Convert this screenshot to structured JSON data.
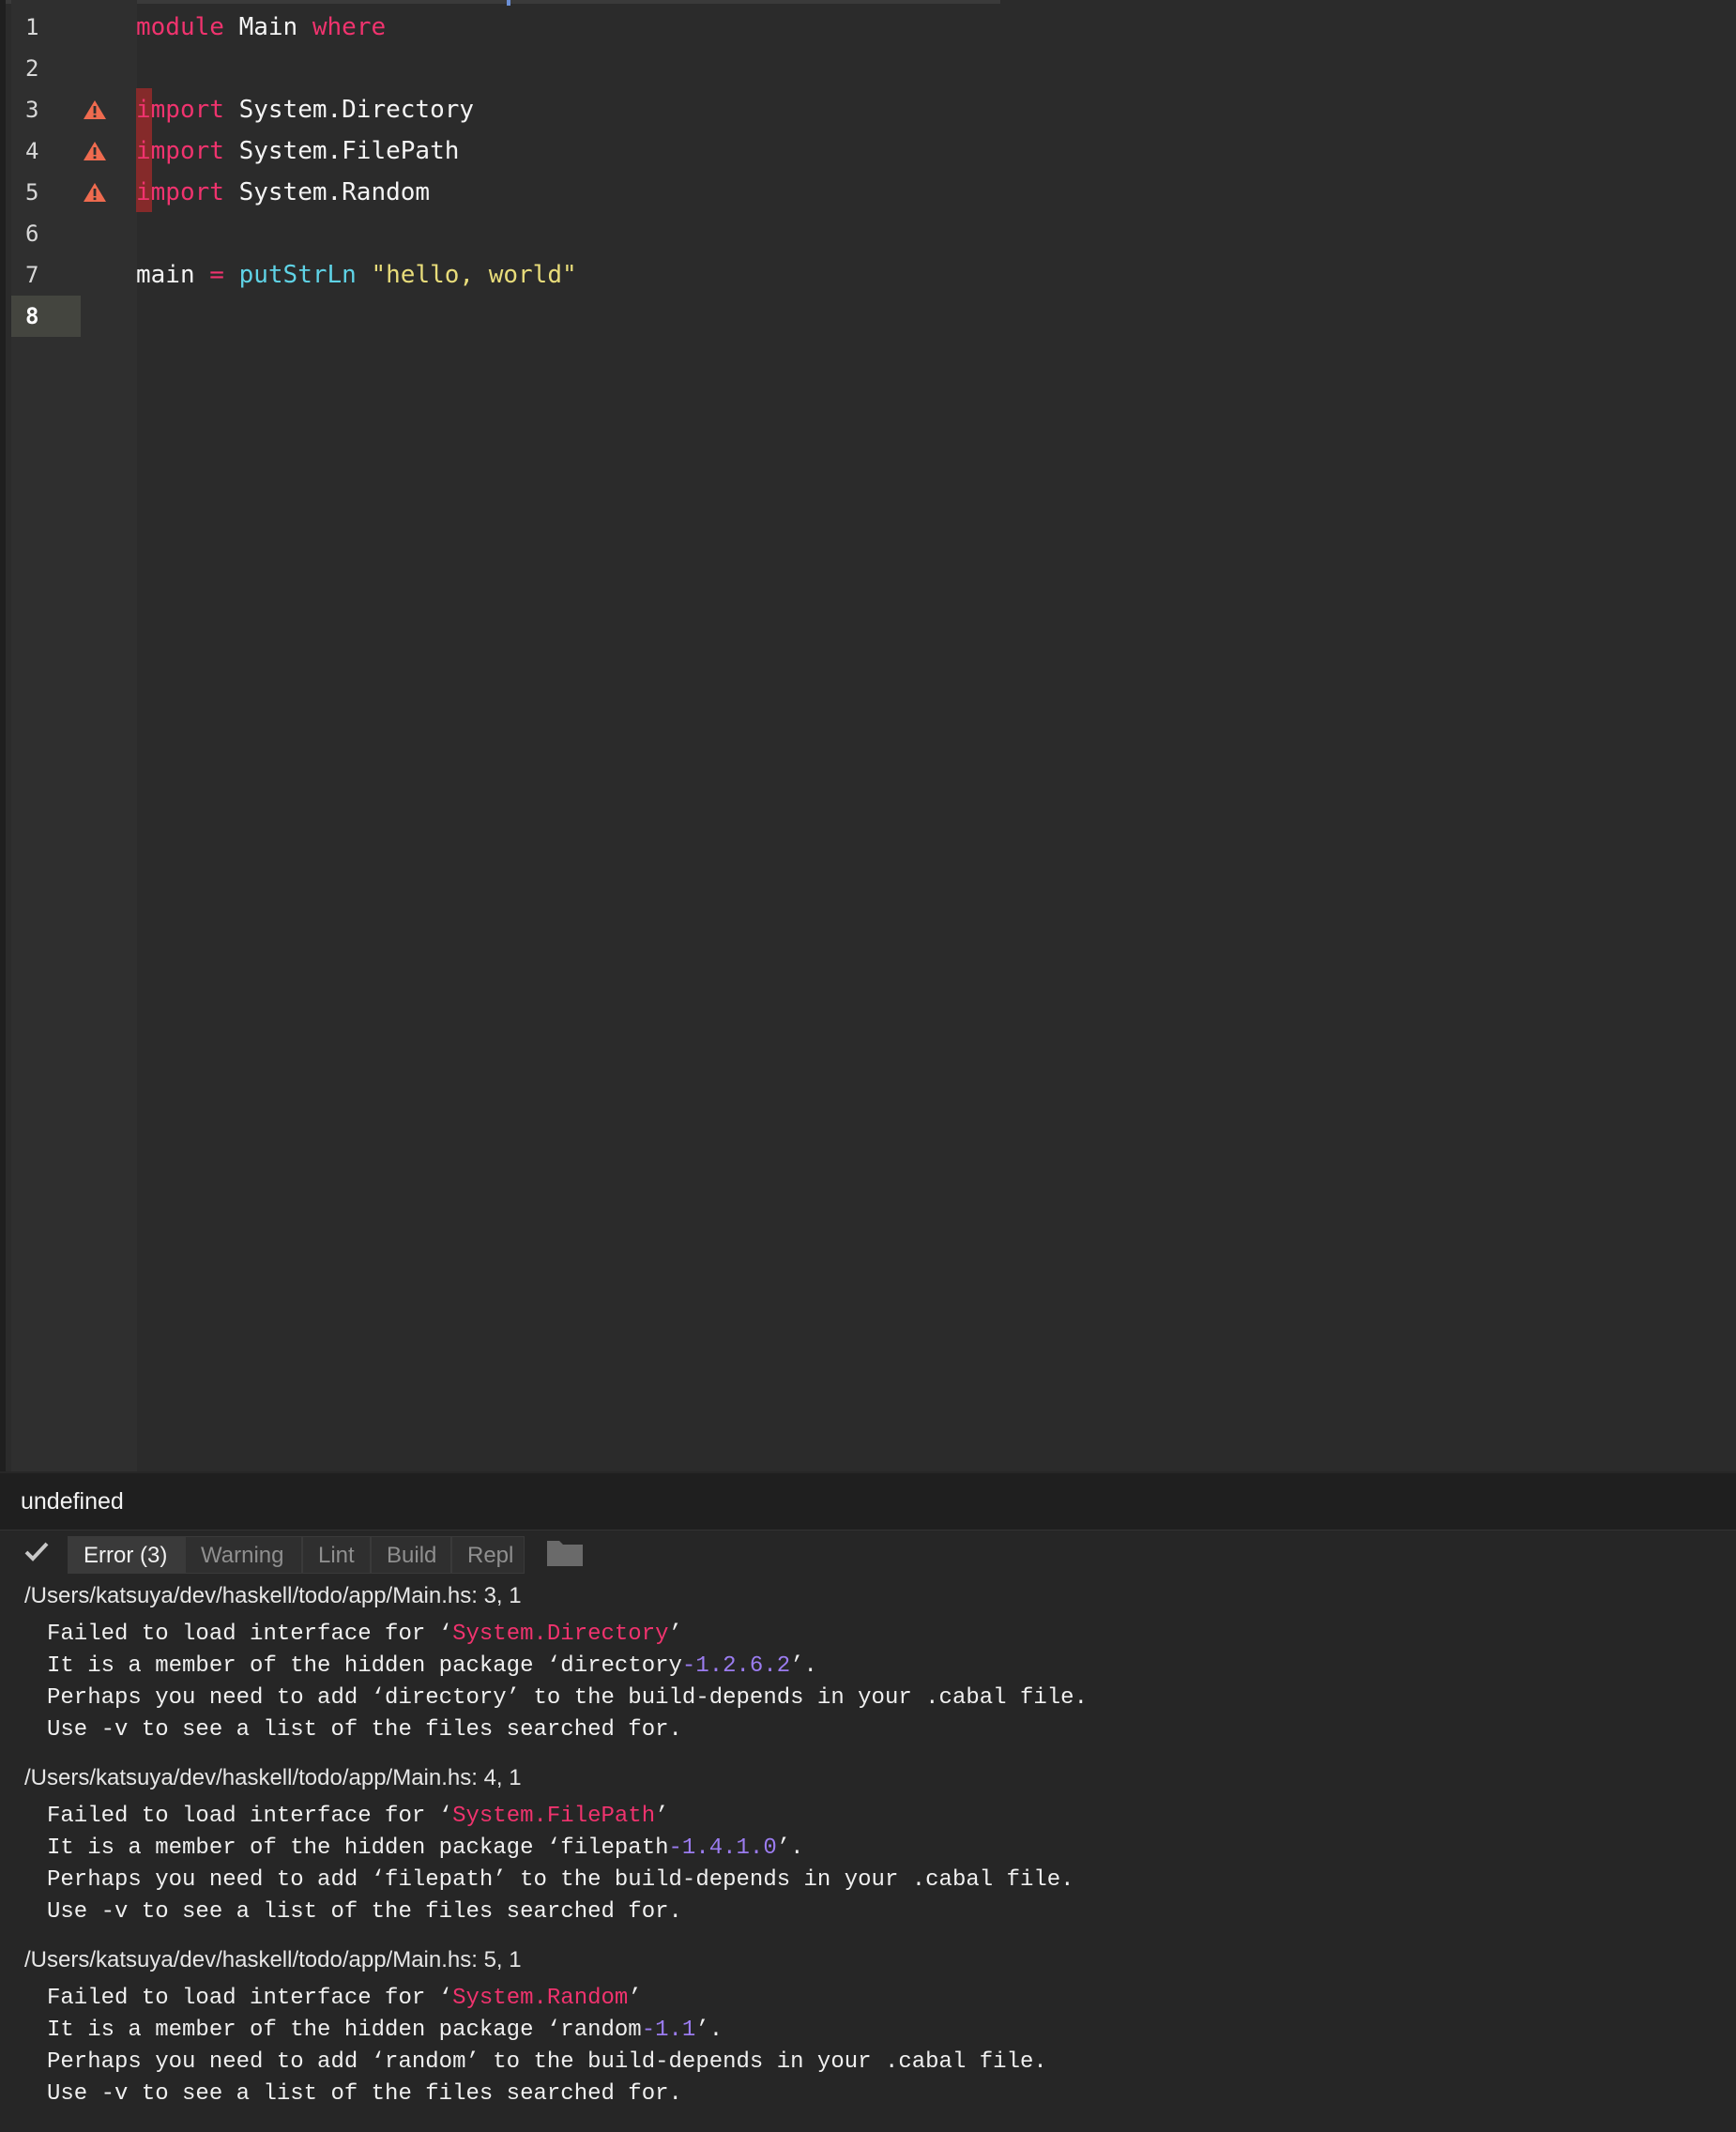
{
  "editor": {
    "gutter": [
      {
        "num": "1",
        "warning": false,
        "current": false
      },
      {
        "num": "2",
        "warning": false,
        "current": false
      },
      {
        "num": "3",
        "warning": true,
        "current": false
      },
      {
        "num": "4",
        "warning": true,
        "current": false
      },
      {
        "num": "5",
        "warning": true,
        "current": false
      },
      {
        "num": "6",
        "warning": false,
        "current": false
      },
      {
        "num": "7",
        "warning": false,
        "current": false
      },
      {
        "num": "8",
        "warning": false,
        "current": true
      }
    ],
    "code": {
      "line1": {
        "kw1": "module",
        "name": "Main",
        "kw2": "where"
      },
      "line3": {
        "kw": "import",
        "mod": "System.Directory"
      },
      "line4": {
        "kw": "import",
        "mod": "System.FilePath"
      },
      "line5": {
        "kw": "import",
        "mod": "System.Random"
      },
      "line7": {
        "name": "main",
        "op": "=",
        "fn": "putStrLn",
        "str": "\"hello, world\""
      }
    },
    "colors": {
      "keyword": "#f0336e",
      "function": "#5fd3e6",
      "string": "#e8dc7a",
      "warning": "#ef6b4f"
    }
  },
  "status_bar": {
    "text": "undefined"
  },
  "panel": {
    "tabs": {
      "error": "Error (3)",
      "warning": "Warning",
      "lint": "Lint",
      "build": "Build",
      "repl": "Repl"
    },
    "errors": [
      {
        "path": "/Users/katsuya/dev/haskell/todo/app/Main.hs: 3, 1",
        "l1_pre": "Failed to load interface for ‘",
        "l1_mod": "System.Directory",
        "l1_post": "’",
        "l2_pre": "It is a member of the hidden package ‘directory",
        "l2_ver": "-1.2.6.2",
        "l2_post": "’.",
        "l3": "Perhaps you need to add ‘directory’ to the build-depends in your .cabal file.",
        "l4": "Use -v to see a list of the files searched for."
      },
      {
        "path": "/Users/katsuya/dev/haskell/todo/app/Main.hs: 4, 1",
        "l1_pre": "Failed to load interface for ‘",
        "l1_mod": "System.FilePath",
        "l1_post": "’",
        "l2_pre": "It is a member of the hidden package ‘filepath",
        "l2_ver": "-1.4.1.0",
        "l2_post": "’.",
        "l3": "Perhaps you need to add ‘filepath’ to the build-depends in your .cabal file.",
        "l4": "Use -v to see a list of the files searched for."
      },
      {
        "path": "/Users/katsuya/dev/haskell/todo/app/Main.hs: 5, 1",
        "l1_pre": "Failed to load interface for ‘",
        "l1_mod": "System.Random",
        "l1_post": "’",
        "l2_pre": "It is a member of the hidden package ‘random",
        "l2_ver": "-1.1",
        "l2_post": "’.",
        "l3": "Perhaps you need to add ‘random’ to the build-depends in your .cabal file.",
        "l4": "Use -v to see a list of the files searched for."
      }
    ]
  }
}
